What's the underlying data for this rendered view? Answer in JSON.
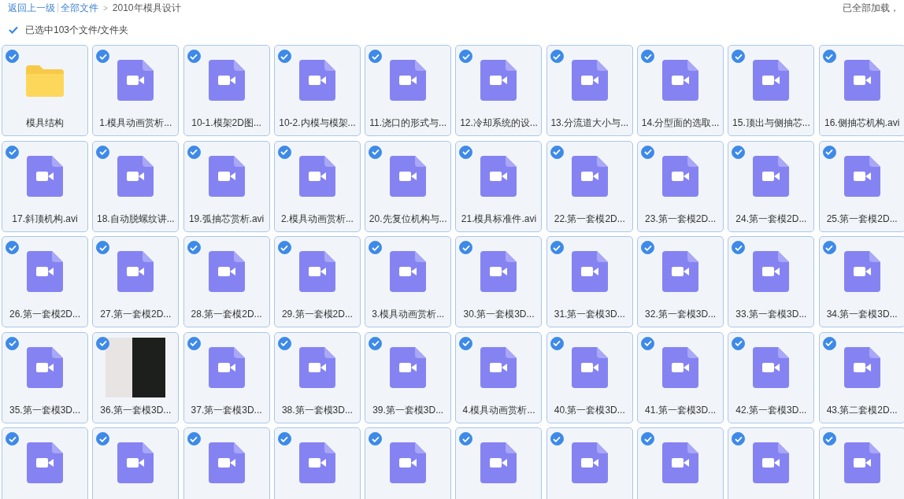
{
  "breadcrumb": {
    "back": "返回上一级",
    "root": "全部文件",
    "separator": ">",
    "current": "2010年模具设计"
  },
  "load_status": "已全部加载，",
  "select_all": {
    "checked": true,
    "label": "已选中103个文件/文件夹"
  },
  "items": [
    {
      "kind": "folder",
      "checked": true,
      "name": "模具结构"
    },
    {
      "kind": "video",
      "checked": true,
      "name": "1.模具动画赏析..."
    },
    {
      "kind": "video",
      "checked": true,
      "name": "10-1.模架2D图..."
    },
    {
      "kind": "video",
      "checked": true,
      "name": "10-2.内模与模架..."
    },
    {
      "kind": "video",
      "checked": true,
      "name": "11.浇口的形式与..."
    },
    {
      "kind": "video",
      "checked": true,
      "name": "12.冷却系统的设..."
    },
    {
      "kind": "video",
      "checked": true,
      "name": "13.分流道大小与..."
    },
    {
      "kind": "video",
      "checked": true,
      "name": "14.分型面的选取..."
    },
    {
      "kind": "video",
      "checked": true,
      "name": "15.顶出与侧抽芯..."
    },
    {
      "kind": "video",
      "checked": true,
      "name": "16.侧抽芯机构.avi"
    },
    {
      "kind": "video",
      "checked": true,
      "name": "17.斜顶机构.avi"
    },
    {
      "kind": "video",
      "checked": true,
      "name": "18.自动脱螺纹讲..."
    },
    {
      "kind": "video",
      "checked": true,
      "name": "19.弧抽芯赏析.avi"
    },
    {
      "kind": "video",
      "checked": true,
      "name": "2.模具动画赏析..."
    },
    {
      "kind": "video",
      "checked": true,
      "name": "20.先复位机构与..."
    },
    {
      "kind": "video",
      "checked": true,
      "name": "21.模具标准件.avi"
    },
    {
      "kind": "video",
      "checked": true,
      "name": "22.第一套模2D..."
    },
    {
      "kind": "video",
      "checked": true,
      "name": "23.第一套模2D..."
    },
    {
      "kind": "video",
      "checked": true,
      "name": "24.第一套模2D..."
    },
    {
      "kind": "video",
      "checked": true,
      "name": "25.第一套模2D..."
    },
    {
      "kind": "video",
      "checked": true,
      "name": "26.第一套模2D..."
    },
    {
      "kind": "video",
      "checked": true,
      "name": "27.第一套模2D..."
    },
    {
      "kind": "video",
      "checked": true,
      "name": "28.第一套模2D..."
    },
    {
      "kind": "video",
      "checked": true,
      "name": "29.第一套模2D..."
    },
    {
      "kind": "video",
      "checked": true,
      "name": "3.模具动画赏析..."
    },
    {
      "kind": "video",
      "checked": true,
      "name": "30.第一套模3D..."
    },
    {
      "kind": "video",
      "checked": true,
      "name": "31.第一套模3D..."
    },
    {
      "kind": "video",
      "checked": true,
      "name": "32.第一套模3D..."
    },
    {
      "kind": "video",
      "checked": true,
      "name": "33.第一套模3D..."
    },
    {
      "kind": "video",
      "checked": true,
      "name": "34.第一套模3D..."
    },
    {
      "kind": "video",
      "checked": true,
      "name": "35.第一套模3D..."
    },
    {
      "kind": "image",
      "checked": true,
      "name": "36.第一套模3D..."
    },
    {
      "kind": "video",
      "checked": true,
      "name": "37.第一套模3D..."
    },
    {
      "kind": "video",
      "checked": true,
      "name": "38.第一套模3D..."
    },
    {
      "kind": "video",
      "checked": true,
      "name": "39.第一套模3D..."
    },
    {
      "kind": "video",
      "checked": true,
      "name": "4.模具动画赏析..."
    },
    {
      "kind": "video",
      "checked": true,
      "name": "40.第一套模3D..."
    },
    {
      "kind": "video",
      "checked": true,
      "name": "41.第一套模3D..."
    },
    {
      "kind": "video",
      "checked": true,
      "name": "42.第一套模3D..."
    },
    {
      "kind": "video",
      "checked": true,
      "name": "43.第二套模2D..."
    },
    {
      "kind": "video",
      "checked": true
    },
    {
      "kind": "video",
      "checked": true
    },
    {
      "kind": "video",
      "checked": true
    },
    {
      "kind": "video",
      "checked": true
    },
    {
      "kind": "video",
      "checked": true
    },
    {
      "kind": "video",
      "checked": true
    },
    {
      "kind": "video",
      "checked": true
    },
    {
      "kind": "video",
      "checked": true
    },
    {
      "kind": "video",
      "checked": true
    },
    {
      "kind": "video",
      "checked": true
    }
  ]
}
